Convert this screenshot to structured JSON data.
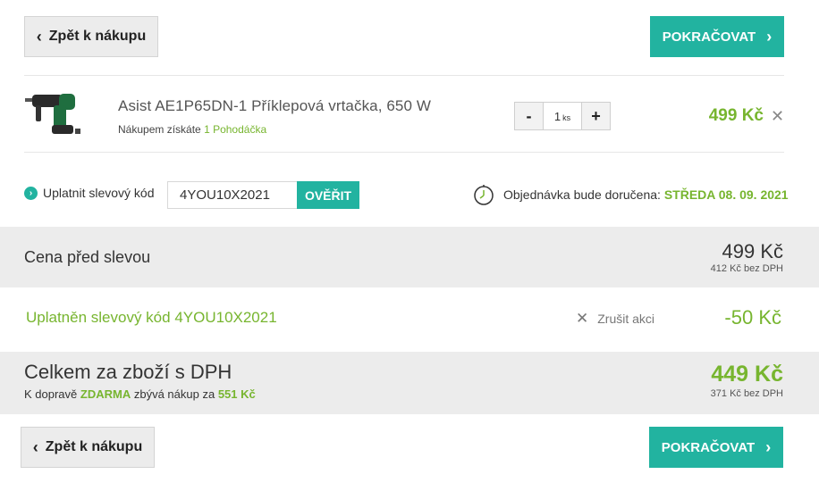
{
  "nav": {
    "back_label": "Zpět k nákupu",
    "continue_label": "POKRAČOVAT"
  },
  "product": {
    "name": "Asist AE1P65DN-1 Příklepová vrtačka, 650 W",
    "points_prefix": "Nákupem získáte",
    "points_value": "1 Pohodáčka",
    "qty_minus": "-",
    "qty_value": "1",
    "qty_unit": "ks",
    "qty_plus": "+",
    "price": "499 Kč",
    "remove_symbol": "✕"
  },
  "coupon": {
    "label": "Uplatnit slevový kód",
    "input_value": "4YOU10X2021",
    "verify_label": "OVĚŘIT"
  },
  "delivery": {
    "label": "Objednávka bude doručena:",
    "date": "STŘEDA 08. 09. 2021"
  },
  "summary": {
    "before_label": "Cena před slevou",
    "before_price": "499 Kč",
    "before_no_vat": "412 Kč bez DPH",
    "applied_label": "Uplatněn slevový kód 4YOU10X2021",
    "cancel_label": "Zrušit akci",
    "discount": "-50 Kč",
    "total_label": "Celkem za zboží s DPH",
    "shipping_prefix": "K dopravě",
    "shipping_free": "ZDARMA",
    "shipping_middle": "zbývá nákup za",
    "shipping_remaining": "551 Kč",
    "total_price": "449 Kč",
    "total_no_vat": "371 Kč bez DPH"
  },
  "colors": {
    "accent": "#22b3a0",
    "price_green": "#77b52f",
    "band_gray": "#ececec"
  }
}
